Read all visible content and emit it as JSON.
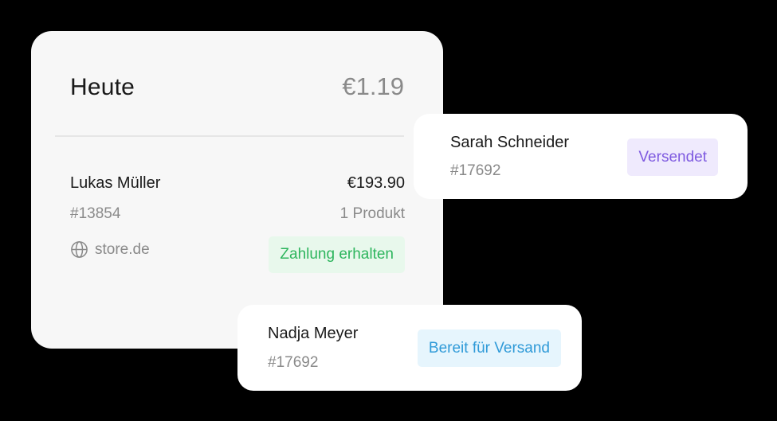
{
  "summary": {
    "title": "Heute",
    "total": "€1.19"
  },
  "main_order": {
    "customer": "Lukas Müller",
    "amount": "€193.90",
    "order_id": "#13854",
    "products": "1 Produkt",
    "store": "store.de",
    "store_icon": "globe-icon",
    "status": "Zahlung erhalten",
    "status_color": "#2db55d"
  },
  "order_sarah": {
    "customer": "Sarah Schneider",
    "order_id": "#17692",
    "status": "Versendet",
    "status_color": "#7e5ae0"
  },
  "order_nadja": {
    "customer": "Nadja Meyer",
    "order_id": "#17692",
    "status": "Bereit für Versand",
    "status_color": "#2f9ad8"
  }
}
